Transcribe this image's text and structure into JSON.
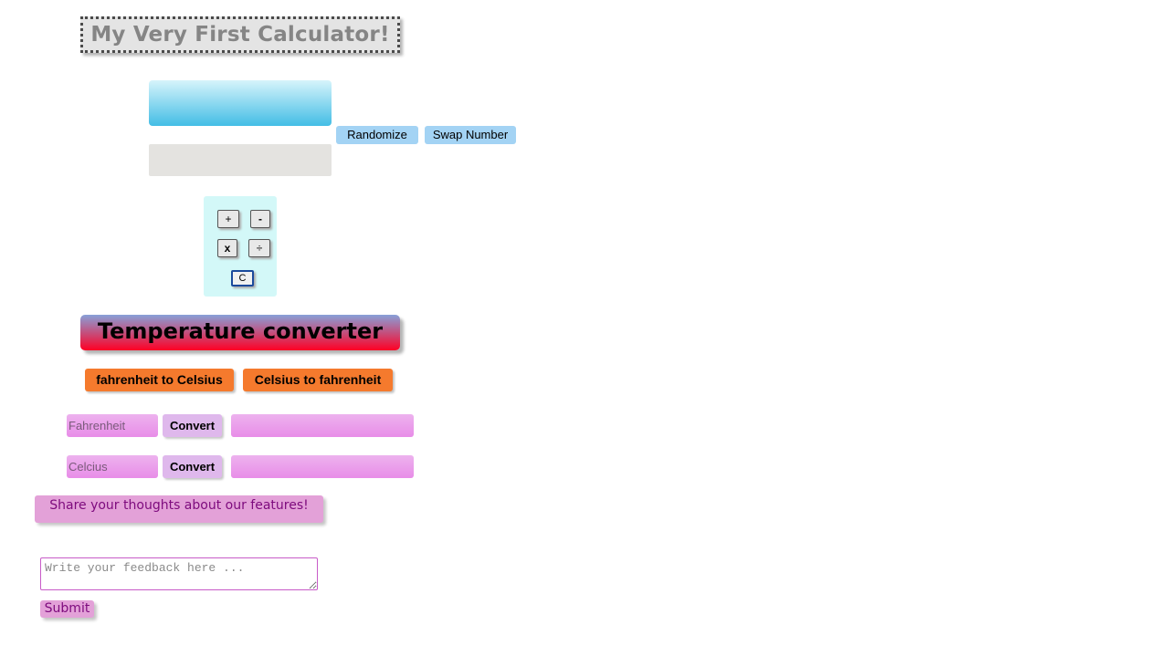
{
  "header": {
    "title": "My Very First Calculator!"
  },
  "calculator": {
    "number1_value": "",
    "number2_value": "",
    "randomize_label": "Randomize",
    "swap_label": "Swap Number",
    "operators": {
      "plus": "+",
      "minus": "-",
      "multiply": "x",
      "divide": "÷",
      "clear": "C"
    }
  },
  "converter": {
    "title": "Temperature converter",
    "tabs": {
      "f_to_c": "fahrenheit to Celsius",
      "c_to_f": "Celsius to fahrenheit"
    },
    "fahrenheit": {
      "placeholder": "Fahrenheit",
      "convert_label": "Convert",
      "result": ""
    },
    "celsius": {
      "placeholder": "Celcius",
      "convert_label": "Convert",
      "result": ""
    }
  },
  "feedback": {
    "heading": "Share your thoughts about our features!",
    "placeholder": "Write your feedback here ...",
    "submit_label": "Submit"
  },
  "colors": {
    "title_bg": "#e4e4e4",
    "accent_blue": "#a3d3f4",
    "operator_panel": "#d3f8f8",
    "orange": "#f57a2d",
    "pink": "#e88de8",
    "feedback_bg": "#e3a1d8",
    "feedback_text": "#7d0a7d"
  }
}
